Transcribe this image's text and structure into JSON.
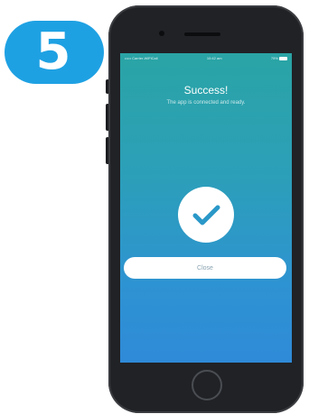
{
  "step": {
    "number": "5"
  },
  "status_bar": {
    "left_text": "••••• Carrier-WiFiCall",
    "time": "10:42 am",
    "right_text": "75%"
  },
  "screen": {
    "title": "Success!",
    "subtitle": "The app is connected and ready.",
    "close_label": "Close"
  },
  "colors": {
    "badge": "#1ea1e3",
    "gradient_top": "#2aa4a5",
    "gradient_bottom": "#2f8ad8",
    "check": "#2a98c8"
  },
  "icons": {
    "success": "checkmark-icon",
    "battery": "battery-icon",
    "home": "home-button-icon"
  }
}
